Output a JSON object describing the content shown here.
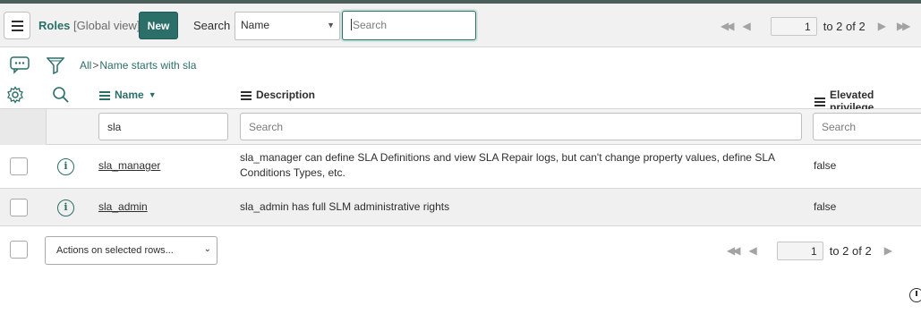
{
  "header": {
    "title": "Roles",
    "view": "[Global view]",
    "new_label": "New",
    "search_label": "Search",
    "search_field": "Name",
    "search_placeholder": "Search",
    "pager": {
      "page": "1",
      "range_text": "to 2 of 2"
    }
  },
  "breadcrumb": {
    "root": "All",
    "separator": ">",
    "filter": "Name starts with sla"
  },
  "columns": [
    {
      "label": "Name",
      "sorted": "descending"
    },
    {
      "label": "Description"
    },
    {
      "label": "Elevated privilege"
    }
  ],
  "filters": {
    "name": "sla",
    "description_placeholder": "Search",
    "elevated_placeholder": "Search"
  },
  "rows": [
    {
      "name": "sla_manager",
      "description": "sla_manager can define SLA Definitions and view SLA Repair logs, but can't change property values, define SLA Conditions Types, etc.",
      "elevated": "false"
    },
    {
      "name": "sla_admin",
      "description": "sla_admin has full SLM administrative rights",
      "elevated": "false"
    }
  ],
  "footer": {
    "actions_label": "Actions on selected rows...",
    "pager": {
      "page": "1",
      "range_text": "to 2 of 2"
    }
  },
  "colors": {
    "accent": "#2b6f68",
    "header_bg": "#f1f1f1",
    "row_alt": "#f0f0f0"
  }
}
